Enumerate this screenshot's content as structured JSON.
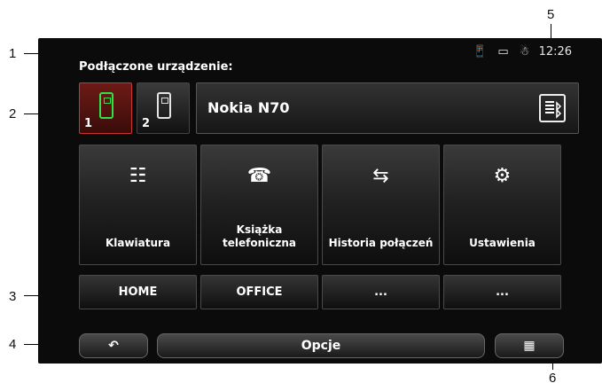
{
  "callouts": [
    "1",
    "2",
    "3",
    "4",
    "5",
    "6"
  ],
  "status": {
    "time": "12:26"
  },
  "header_label": "Podłączone urządzenie:",
  "devices": [
    {
      "num": "1"
    },
    {
      "num": "2"
    }
  ],
  "device_name": "Nokia N70",
  "main_buttons": [
    {
      "label": "Klawiatura"
    },
    {
      "label": "Książka telefoniczna"
    },
    {
      "label": "Historia połączeń"
    },
    {
      "label": "Ustawienia"
    }
  ],
  "quick_buttons": [
    "HOME",
    "OFFICE",
    "...",
    "..."
  ],
  "bottom": {
    "options_label": "Opcje"
  }
}
